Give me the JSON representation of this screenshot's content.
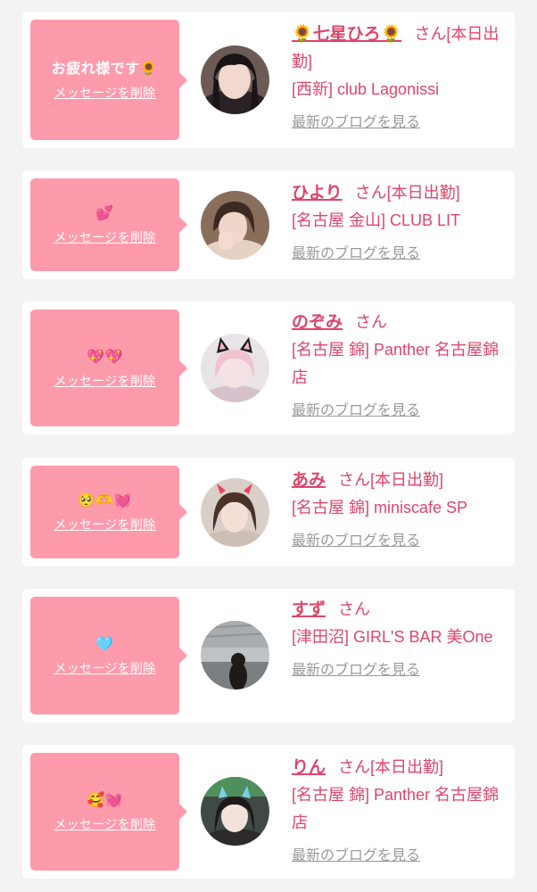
{
  "delete_label": "メッセージを削除",
  "blog_label": "最新のブログを見る",
  "honorific": "さん",
  "cards": [
    {
      "message": "お疲れ様です🌻",
      "name": "🌻七星ひろ🌻",
      "status": "[本日出勤]",
      "shop": "[西新] club Lagonissi"
    },
    {
      "message": "💕",
      "name": "ひより",
      "status": "[本日出勤]",
      "shop": "[名古屋 金山] CLUB LIT"
    },
    {
      "message": "💖💖",
      "name": "のぞみ",
      "status": "",
      "shop": "[名古屋 錦] Panther 名古屋錦店"
    },
    {
      "message": "🥺🫶💓",
      "name": "あみ",
      "status": "[本日出勤]",
      "shop": "[名古屋 錦] miniscafe SP"
    },
    {
      "message": "🩵",
      "name": "すず",
      "status": "",
      "shop": "[津田沼] GIRL'S BAR 美One"
    },
    {
      "message": "🥰💓",
      "name": "りん",
      "status": "[本日出勤]",
      "shop": "[名古屋 錦] Panther 名古屋錦店"
    }
  ]
}
